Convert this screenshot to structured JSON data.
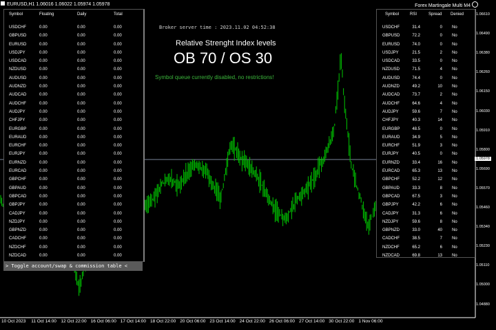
{
  "window": {
    "title": "EURUSD,H1  1.06016 1.06022 1.05974 1.05978",
    "expert_name": "Forex Martingale Multi M4"
  },
  "left_table": {
    "headers": [
      "Symbol",
      "Floating",
      "Daily",
      "Total"
    ],
    "rows": [
      [
        "USDCHF",
        "0.00",
        "0.00",
        "0.00"
      ],
      [
        "GBPUSD",
        "0.00",
        "0.00",
        "0.00"
      ],
      [
        "EURUSD",
        "0.00",
        "0.00",
        "0.00"
      ],
      [
        "USDJPY",
        "0.00",
        "0.00",
        "0.00"
      ],
      [
        "USDCAD",
        "0.00",
        "0.00",
        "0.00"
      ],
      [
        "NZDUSD",
        "0.00",
        "0.00",
        "0.00"
      ],
      [
        "AUDUSD",
        "0.00",
        "0.00",
        "0.00"
      ],
      [
        "AUDNZD",
        "0.00",
        "0.00",
        "0.00"
      ],
      [
        "AUDCAD",
        "0.00",
        "0.00",
        "0.00"
      ],
      [
        "AUDCHF",
        "0.00",
        "0.00",
        "0.00"
      ],
      [
        "AUDJPY",
        "0.00",
        "0.00",
        "0.00"
      ],
      [
        "CHFJPY",
        "0.00",
        "0.00",
        "0.00"
      ],
      [
        "EURGBP",
        "0.00",
        "0.00",
        "0.00"
      ],
      [
        "EURAUD",
        "0.00",
        "0.00",
        "0.00"
      ],
      [
        "EURCHF",
        "0.00",
        "0.00",
        "0.00"
      ],
      [
        "EURJPY",
        "0.00",
        "0.00",
        "0.00"
      ],
      [
        "EURNZD",
        "0.00",
        "0.00",
        "0.00"
      ],
      [
        "EURCAD",
        "0.00",
        "0.00",
        "0.00"
      ],
      [
        "GBPCHF",
        "0.00",
        "0.00",
        "0.00"
      ],
      [
        "GBPAUD",
        "0.00",
        "0.00",
        "0.00"
      ],
      [
        "GBPCAD",
        "0.00",
        "0.00",
        "0.00"
      ],
      [
        "GBPJPY",
        "0.00",
        "0.00",
        "0.00"
      ],
      [
        "CADJPY",
        "0.00",
        "0.00",
        "0.00"
      ],
      [
        "NZDJPY",
        "0.00",
        "0.00",
        "0.00"
      ],
      [
        "GBPNZD",
        "0.00",
        "0.00",
        "0.00"
      ],
      [
        "CADCHF",
        "0.00",
        "0.00",
        "0.00"
      ],
      [
        "NZDCHF",
        "0.00",
        "0.00",
        "0.00"
      ],
      [
        "NZDCAD",
        "0.00",
        "0.00",
        "0.00"
      ]
    ]
  },
  "toggle_label": "> Toggle account/swap & commission table <",
  "server_time": "Broker server time : 2023.11.02 04:52:38",
  "rsi_title": "Relative Strenght Index levels",
  "rsi_levels": "OB 70 / OS 30",
  "queue_status": "Symbol queue currently disabled, no restrictions!",
  "right_table": {
    "headers": [
      "Symbol",
      "RSI",
      "Spread",
      "Denied"
    ],
    "rows": [
      [
        "USDCHF",
        "31.4",
        "0",
        "No"
      ],
      [
        "GBPUSD",
        "72.2",
        "0",
        "No"
      ],
      [
        "EURUSD",
        "74.0",
        "0",
        "No"
      ],
      [
        "USDJPY",
        "21.5",
        "2",
        "No"
      ],
      [
        "USDCAD",
        "33.5",
        "0",
        "No"
      ],
      [
        "NZDUSD",
        "71.5",
        "4",
        "No"
      ],
      [
        "AUDUSD",
        "74.4",
        "0",
        "No"
      ],
      [
        "AUDNZD",
        "49.2",
        "10",
        "No"
      ],
      [
        "AUDCAD",
        "73.7",
        "2",
        "No"
      ],
      [
        "AUDCHF",
        "64.6",
        "4",
        "No"
      ],
      [
        "AUDJPY",
        "59.6",
        "7",
        "No"
      ],
      [
        "CHFJPY",
        "40.3",
        "14",
        "No"
      ],
      [
        "EURGBP",
        "48.5",
        "0",
        "No"
      ],
      [
        "EURAUD",
        "34.9",
        "5",
        "No"
      ],
      [
        "EURCHF",
        "51.9",
        "3",
        "No"
      ],
      [
        "EURJPY",
        "40.5",
        "0",
        "No"
      ],
      [
        "EURNZD",
        "33.4",
        "16",
        "No"
      ],
      [
        "EURCAD",
        "65.3",
        "13",
        "No"
      ],
      [
        "GBPCHF",
        "52.2",
        "12",
        "No"
      ],
      [
        "GBPAUD",
        "33.3",
        "8",
        "No"
      ],
      [
        "GBPCAD",
        "67.5",
        "3",
        "No"
      ],
      [
        "GBPJPY",
        "42.2",
        "6",
        "No"
      ],
      [
        "CADJPY",
        "31.3",
        "6",
        "No"
      ],
      [
        "NZDJPY",
        "59.6",
        "8",
        "No"
      ],
      [
        "GBPNZD",
        "33.0",
        "40",
        "No"
      ],
      [
        "CADCHF",
        "38.5",
        "7",
        "No"
      ],
      [
        "NZDCHF",
        "65.2",
        "6",
        "No"
      ],
      [
        "NZDCAD",
        "69.8",
        "13",
        "No"
      ]
    ]
  },
  "price_axis": {
    "ticks": [
      "1.06610",
      "1.06490",
      "1.06380",
      "1.06260",
      "1.06150",
      "1.06030",
      "1.05910",
      "1.05800",
      "1.05690",
      "1.05570",
      "1.05460",
      "1.05340",
      "1.05230",
      "1.05110",
      "1.05000",
      "1.04880"
    ],
    "current_price": "1.05978"
  },
  "time_axis": {
    "labels": [
      "10 Oct 2023",
      "11 Oct 14:00",
      "12 Oct 22:00",
      "16 Oct 06:00",
      "17 Oct 14:00",
      "18 Oct 22:00",
      "20 Oct 06:00",
      "23 Oct 14:00",
      "24 Oct 22:00",
      "26 Oct 06:00",
      "27 Oct 14:00",
      "30 Oct 22:00",
      "1 Nov 06:00"
    ]
  },
  "colors": {
    "candle": "#00c800",
    "header_text": "#ff8c00",
    "queue_text": "#3cb83c",
    "bid_line": "#7a869a"
  }
}
